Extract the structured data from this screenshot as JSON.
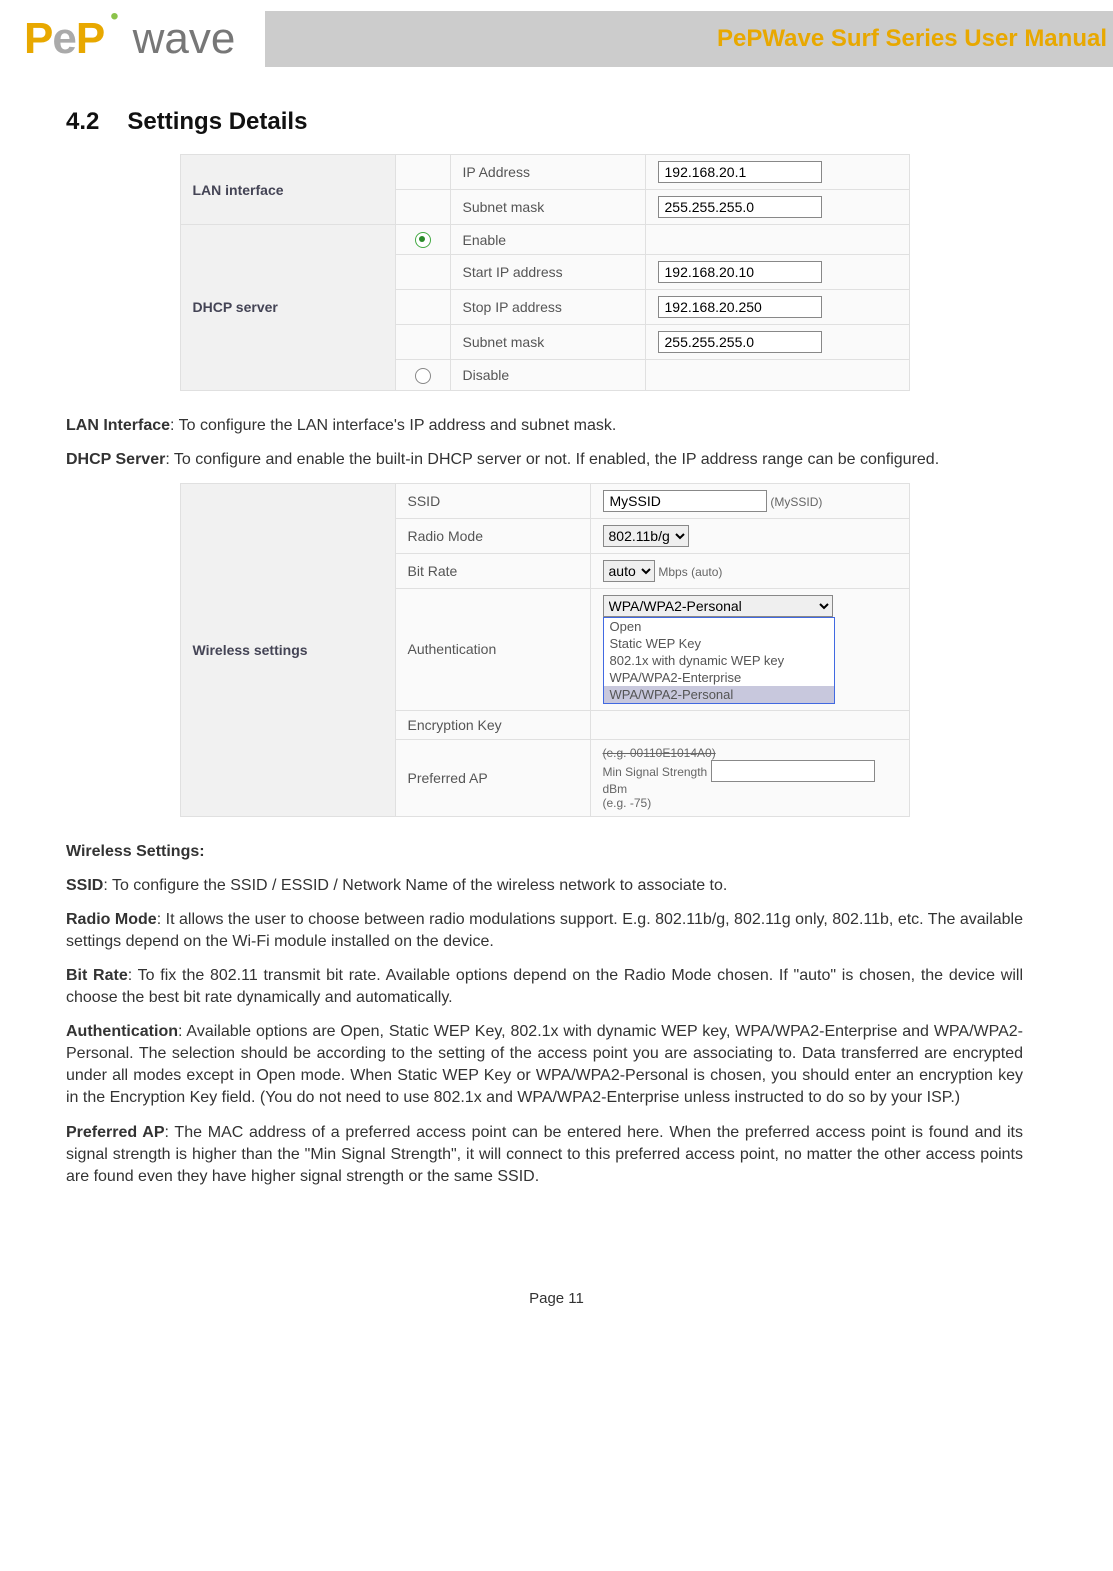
{
  "header": {
    "brand_p1": "P",
    "brand_e": "e",
    "brand_p2": "P",
    "brand_wave": "wave",
    "manual_title": "PePWave Surf Series User Manual"
  },
  "section": {
    "num": "4.2",
    "title": "Settings Details"
  },
  "lan_panel": {
    "side_lan": "LAN interface",
    "side_dhcp": "DHCP server",
    "ip_label": "IP Address",
    "ip_value": "192.168.20.1",
    "mask_label": "Subnet mask",
    "mask_value": "255.255.255.0",
    "enable_label": "Enable",
    "start_label": "Start IP address",
    "start_value": "192.168.20.10",
    "stop_label": "Stop IP address",
    "stop_value": "192.168.20.250",
    "mask2_label": "Subnet mask",
    "mask2_value": "255.255.255.0",
    "disable_label": "Disable"
  },
  "lan_desc": {
    "lan_term": "LAN Interface",
    "lan_text": ": To configure the LAN interface's IP address and subnet mask.",
    "dhcp_term": "DHCP Server",
    "dhcp_text": ": To configure and enable the built-in DHCP server or not.  If enabled, the IP address range can be configured."
  },
  "wifi_panel": {
    "side": "Wireless settings",
    "ssid_label": "SSID",
    "ssid_value": "MySSID",
    "ssid_hint": "(MySSID)",
    "radio_label": "Radio Mode",
    "radio_value": "802.11b/g",
    "bitrate_label": "Bit Rate",
    "bitrate_value": "auto",
    "bitrate_unit": "Mbps (auto)",
    "auth_label": "Authentication",
    "auth_value": "WPA/WPA2-Personal",
    "auth_opts": [
      "Open",
      "Static WEP Key",
      "802.1x with dynamic WEP key",
      "WPA/WPA2-Enterprise",
      "WPA/WPA2-Personal"
    ],
    "enc_label": "Encryption Key",
    "pref_label": "Preferred AP",
    "pref_hint1": "(e.g. 00110E1014A0)",
    "min_label": "Min Signal Strength",
    "min_unit": "dBm",
    "min_hint": "(e.g. -75)"
  },
  "wifi_desc": {
    "heading": "Wireless Settings:",
    "ssid_term": "SSID",
    "ssid_text": ": To configure the SSID / ESSID / Network Name of the wireless network to associate to.",
    "radio_term": "Radio Mode",
    "radio_text": ": It allows the user to choose between radio modulations support.  E.g. 802.11b/g, 802.11g only, 802.11b, etc.  The available settings depend on the Wi-Fi module installed on the device.",
    "bitrate_term": "Bit Rate",
    "bitrate_text": ": To fix the 802.11 transmit bit rate.  Available options depend on the Radio Mode chosen.  If \"auto\" is chosen, the device will choose the best bit rate dynamically and automatically.",
    "auth_term": "Authentication",
    "auth_text": ": Available options are Open, Static WEP Key, 802.1x with dynamic WEP key, WPA/WPA2-Enterprise and WPA/WPA2-Personal.  The selection should be according to the setting of the access point you are associating to.  Data transferred are encrypted under all modes except in Open mode.  When Static WEP Key or WPA/WPA2-Personal is chosen, you should enter an encryption key in the Encryption Key field.  (You do not need to use 802.1x and WPA/WPA2-Enterprise unless instructed to do so by your ISP.)",
    "pref_term": "Preferred AP",
    "pref_text": ": The MAC address of a preferred access point can be entered here.  When the preferred access point is found and its signal strength is higher than the \"Min Signal Strength\", it will connect to this preferred access point, no matter the other access points are found even they have higher signal strength or the same SSID."
  },
  "footer": {
    "page": "Page 11"
  }
}
